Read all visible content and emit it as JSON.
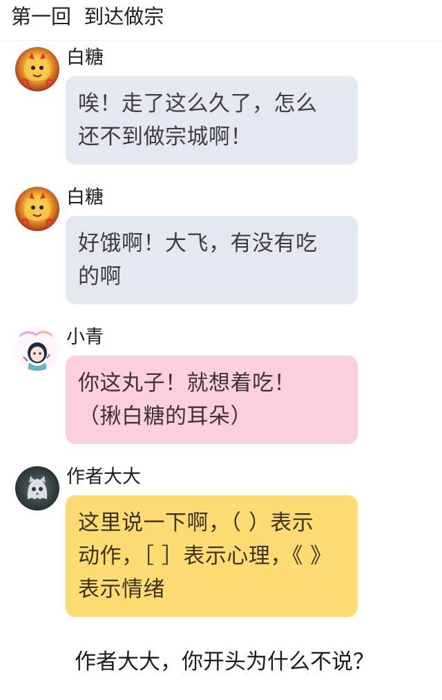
{
  "header": {
    "title": "第一回  到达做宗"
  },
  "messages": [
    {
      "sender": "白糖",
      "avatar_icon": "golden-dragon-avatar-icon",
      "bubble_color": "#e4e8ef",
      "lines": [
        "唉！走了这么久了，怎么",
        "还不到做宗城啊！"
      ]
    },
    {
      "sender": "白糖",
      "avatar_icon": "golden-dragon-avatar-icon",
      "bubble_color": "#e4e8ef",
      "lines": [
        "好饿啊！大飞，有没有吃",
        "的啊"
      ]
    },
    {
      "sender": "小青",
      "avatar_icon": "anime-girl-avatar-icon",
      "bubble_color": "#fbd0dc",
      "lines": [
        "你这丸子！就想着吃！",
        "（揪白糖的耳朵）"
      ]
    },
    {
      "sender": "作者大大",
      "avatar_icon": "ghost-cat-avatar-icon",
      "bubble_color": "#fddc72",
      "lines": [
        "这里说一下啊，（ ）表示",
        "动作，［ ］表示心理，《 》",
        "表示情绪"
      ]
    }
  ],
  "footer": {
    "question": "作者大大，你开头为什么不说？"
  }
}
